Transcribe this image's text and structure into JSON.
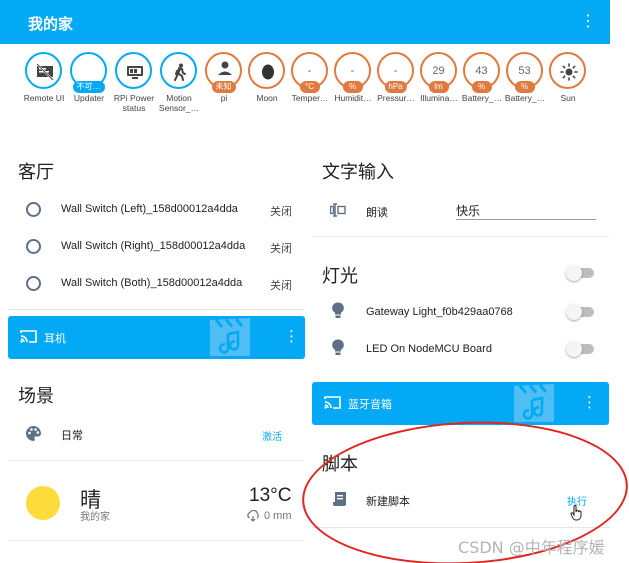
{
  "header": {
    "title": "我的家",
    "menu_icon": "more-vert-icon",
    "color": "#03a9f4"
  },
  "badges": [
    {
      "icon": "remote-ui-icon",
      "label": "Remote UI",
      "chip": "",
      "value": "",
      "style": "blue"
    },
    {
      "icon": "",
      "label": "Updater",
      "chip": "不可…",
      "value": "",
      "style": "blue"
    },
    {
      "icon": "rpi-status-icon",
      "label": "RPi Power status",
      "chip": "",
      "value": "",
      "style": "blue"
    },
    {
      "icon": "walk-icon",
      "label": "Motion Sensor_…",
      "chip": "",
      "value": "",
      "style": "blue"
    },
    {
      "icon": "person-icon",
      "label": "pi",
      "chip": "未知",
      "value": "",
      "style": "orange"
    },
    {
      "icon": "moon-icon",
      "label": "Moon",
      "chip": "",
      "value": "",
      "style": "orange"
    },
    {
      "icon": "",
      "label": "Temper…",
      "chip": "°C",
      "value": "-",
      "style": "orange"
    },
    {
      "icon": "",
      "label": "Humidit…",
      "chip": "%",
      "value": "-",
      "style": "orange"
    },
    {
      "icon": "",
      "label": "Pressur…",
      "chip": "hPa",
      "value": "-",
      "style": "orange"
    },
    {
      "icon": "",
      "label": "Illumina…",
      "chip": "lm",
      "value": "29",
      "style": "orange"
    },
    {
      "icon": "",
      "label": "Battery_…",
      "chip": "%",
      "value": "43",
      "style": "orange"
    },
    {
      "icon": "",
      "label": "Battery_…",
      "chip": "%",
      "value": "53",
      "style": "orange"
    },
    {
      "icon": "sun-icon",
      "label": "Sun",
      "chip": "",
      "value": "",
      "style": "orange"
    }
  ],
  "living_room": {
    "title": "客厅",
    "rows": [
      {
        "name": "Wall Switch (Left)_158d00012a4dda",
        "state": "关闭"
      },
      {
        "name": "Wall Switch (Right)_158d00012a4dda",
        "state": "关闭"
      },
      {
        "name": "Wall Switch (Both)_158d00012a4dda",
        "state": "关闭"
      }
    ]
  },
  "media_left": {
    "name": "耳机"
  },
  "scenes": {
    "title": "场景",
    "name": "日常",
    "action": "激活"
  },
  "weather": {
    "condition": "晴",
    "location": "我的家",
    "temperature": "13",
    "unit": "°C",
    "precip": "0 mm"
  },
  "text_input": {
    "title": "文字输入",
    "label": "朗读",
    "value": "快乐"
  },
  "lights": {
    "title": "灯光",
    "rows": [
      {
        "name": "Gateway Light_f0b429aa0768"
      },
      {
        "name": "LED On NodeMCU Board"
      }
    ]
  },
  "media_right": {
    "name": "蓝牙音箱"
  },
  "scripts": {
    "title": "脚本",
    "name": "新建脚本",
    "action": "执行"
  },
  "watermark": "CSDN @中年程序媛"
}
